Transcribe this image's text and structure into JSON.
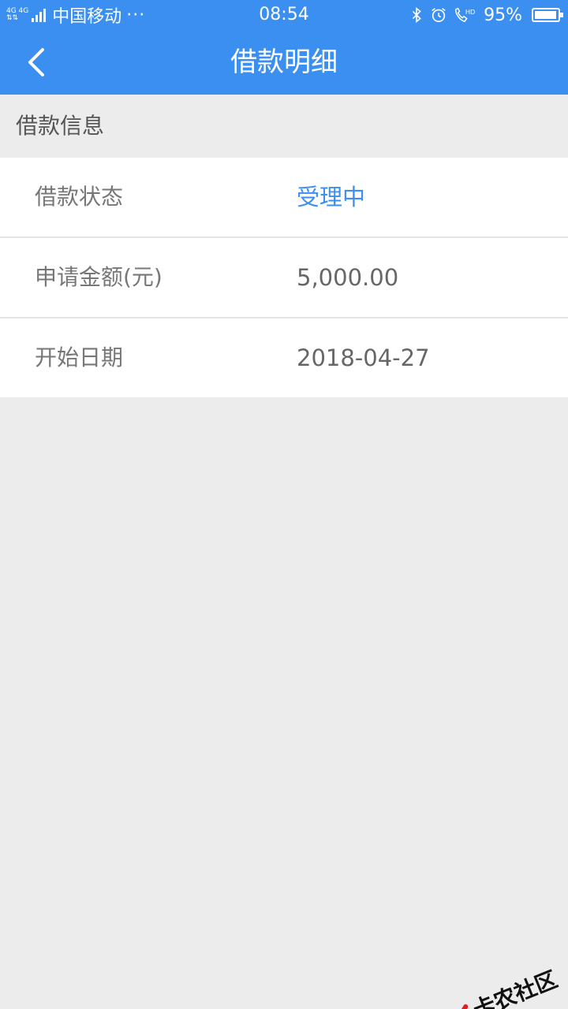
{
  "status_bar": {
    "network_top": "4G 4G",
    "carrier": "中国移动",
    "dots": "···",
    "time": "08:54",
    "battery_percent": "95%",
    "battery_level": 0.95,
    "icons": [
      "bluetooth-icon",
      "alarm-icon",
      "hd-call-icon",
      "battery-icon"
    ]
  },
  "nav": {
    "title": "借款明细",
    "back_icon": "chevron-left-icon"
  },
  "section": {
    "title": "借款信息"
  },
  "rows": [
    {
      "label": "借款状态",
      "value": "受理中"
    },
    {
      "label": "申请金额(元)",
      "value": "5,000.00"
    },
    {
      "label": "开始日期",
      "value": "2018-04-27"
    }
  ],
  "watermark": {
    "text": "卡农社区"
  },
  "colors": {
    "accent": "#3a8ff0",
    "background": "#ececec",
    "label": "#777777",
    "value": "#666666"
  }
}
